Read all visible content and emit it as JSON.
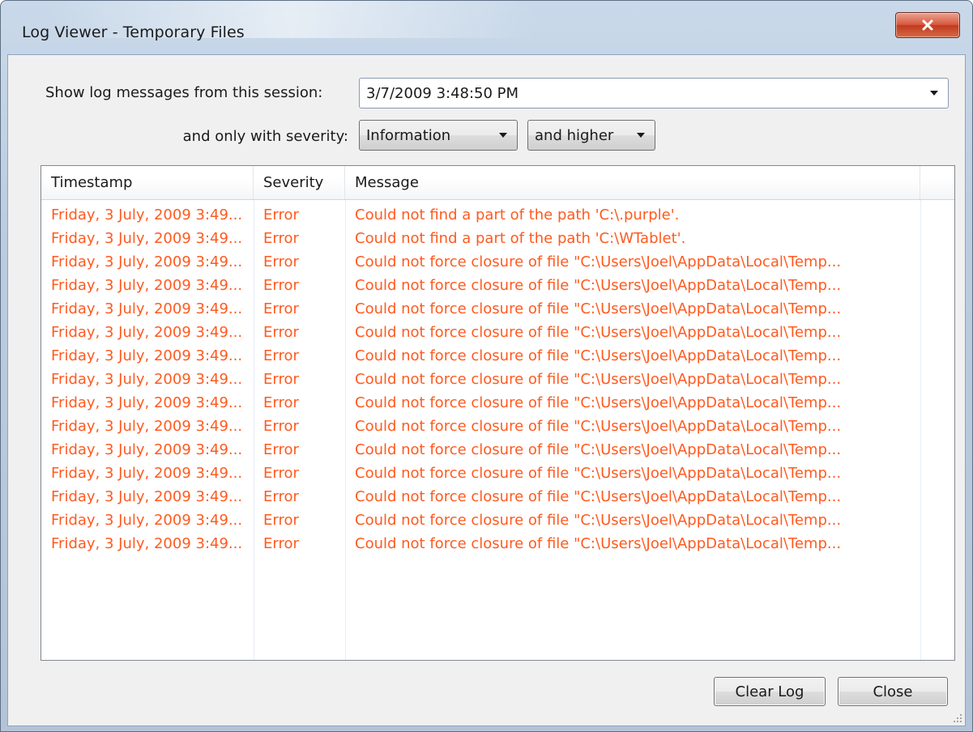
{
  "window": {
    "title": "Log Viewer - Temporary Files"
  },
  "filters": {
    "session_label": "Show log messages from this session:",
    "session_value": "3/7/2009 3:48:50 PM",
    "severity_label": "and only with severity:",
    "severity_value": "Information",
    "severity_scope_value": "and higher"
  },
  "log_table": {
    "columns": [
      "Timestamp",
      "Severity",
      "Message"
    ],
    "rows": [
      {
        "timestamp": "Friday, 3 July, 2009 3:49...",
        "severity": "Error",
        "message": "Could not find a part of the path 'C:\\.purple'."
      },
      {
        "timestamp": "Friday, 3 July, 2009 3:49...",
        "severity": "Error",
        "message": "Could not find a part of the path 'C:\\WTablet'."
      },
      {
        "timestamp": "Friday, 3 July, 2009 3:49...",
        "severity": "Error",
        "message": "Could not force closure of file \"C:\\Users\\Joel\\AppData\\Local\\Temp..."
      },
      {
        "timestamp": "Friday, 3 July, 2009 3:49...",
        "severity": "Error",
        "message": "Could not force closure of file \"C:\\Users\\Joel\\AppData\\Local\\Temp..."
      },
      {
        "timestamp": "Friday, 3 July, 2009 3:49...",
        "severity": "Error",
        "message": "Could not force closure of file \"C:\\Users\\Joel\\AppData\\Local\\Temp..."
      },
      {
        "timestamp": "Friday, 3 July, 2009 3:49...",
        "severity": "Error",
        "message": "Could not force closure of file \"C:\\Users\\Joel\\AppData\\Local\\Temp..."
      },
      {
        "timestamp": "Friday, 3 July, 2009 3:49...",
        "severity": "Error",
        "message": "Could not force closure of file \"C:\\Users\\Joel\\AppData\\Local\\Temp..."
      },
      {
        "timestamp": "Friday, 3 July, 2009 3:49...",
        "severity": "Error",
        "message": "Could not force closure of file \"C:\\Users\\Joel\\AppData\\Local\\Temp..."
      },
      {
        "timestamp": "Friday, 3 July, 2009 3:49...",
        "severity": "Error",
        "message": "Could not force closure of file \"C:\\Users\\Joel\\AppData\\Local\\Temp..."
      },
      {
        "timestamp": "Friday, 3 July, 2009 3:49...",
        "severity": "Error",
        "message": "Could not force closure of file \"C:\\Users\\Joel\\AppData\\Local\\Temp..."
      },
      {
        "timestamp": "Friday, 3 July, 2009 3:49...",
        "severity": "Error",
        "message": "Could not force closure of file \"C:\\Users\\Joel\\AppData\\Local\\Temp..."
      },
      {
        "timestamp": "Friday, 3 July, 2009 3:49...",
        "severity": "Error",
        "message": "Could not force closure of file \"C:\\Users\\Joel\\AppData\\Local\\Temp..."
      },
      {
        "timestamp": "Friday, 3 July, 2009 3:49...",
        "severity": "Error",
        "message": "Could not force closure of file \"C:\\Users\\Joel\\AppData\\Local\\Temp..."
      },
      {
        "timestamp": "Friday, 3 July, 2009 3:49...",
        "severity": "Error",
        "message": "Could not force closure of file \"C:\\Users\\Joel\\AppData\\Local\\Temp..."
      },
      {
        "timestamp": "Friday, 3 July, 2009 3:49...",
        "severity": "Error",
        "message": "Could not force closure of file \"C:\\Users\\Joel\\AppData\\Local\\Temp..."
      }
    ]
  },
  "actions": {
    "clear_log_label": "Clear Log",
    "close_label": "Close"
  },
  "colors": {
    "error_text": "#ff5a1f",
    "client_background": "#f0f0f0",
    "title_close_button": "#c9452a"
  },
  "icons": {
    "title_close": "close-x-icon",
    "dropdown": "chevron-down-icon",
    "resize": "resize-grip-icon"
  }
}
